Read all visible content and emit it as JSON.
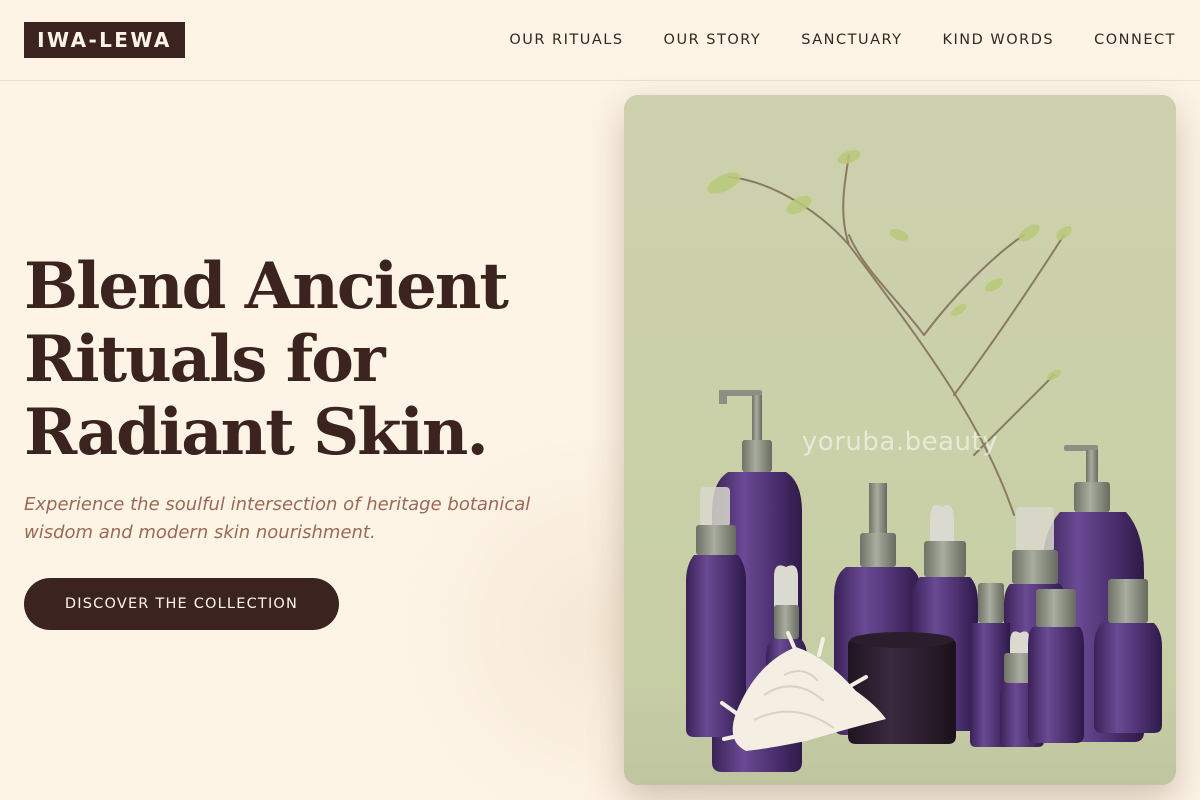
{
  "brand": {
    "logo": "IWA-LEWA"
  },
  "nav": {
    "items": [
      {
        "label": "OUR RITUALS"
      },
      {
        "label": "OUR STORY"
      },
      {
        "label": "SANCTUARY"
      },
      {
        "label": "KIND WORDS"
      },
      {
        "label": "CONNECT"
      }
    ]
  },
  "hero": {
    "title_lines": [
      "Blend Ancient",
      "Rituals for",
      "Radiant Skin."
    ],
    "subtitle": "Experience the soulful intersection of heritage botanical wisdom and modern skin nourishment.",
    "cta_label": "DISCOVER THE COLLECTION"
  },
  "image": {
    "watermark": "yoruba.beauty"
  },
  "colors": {
    "background": "#fdf4e6",
    "brand_dark": "#3b2420",
    "subtitle": "#9a6a55",
    "photo_backdrop": "#c9d0a7",
    "bottle_purple": "#4b2f6e"
  }
}
